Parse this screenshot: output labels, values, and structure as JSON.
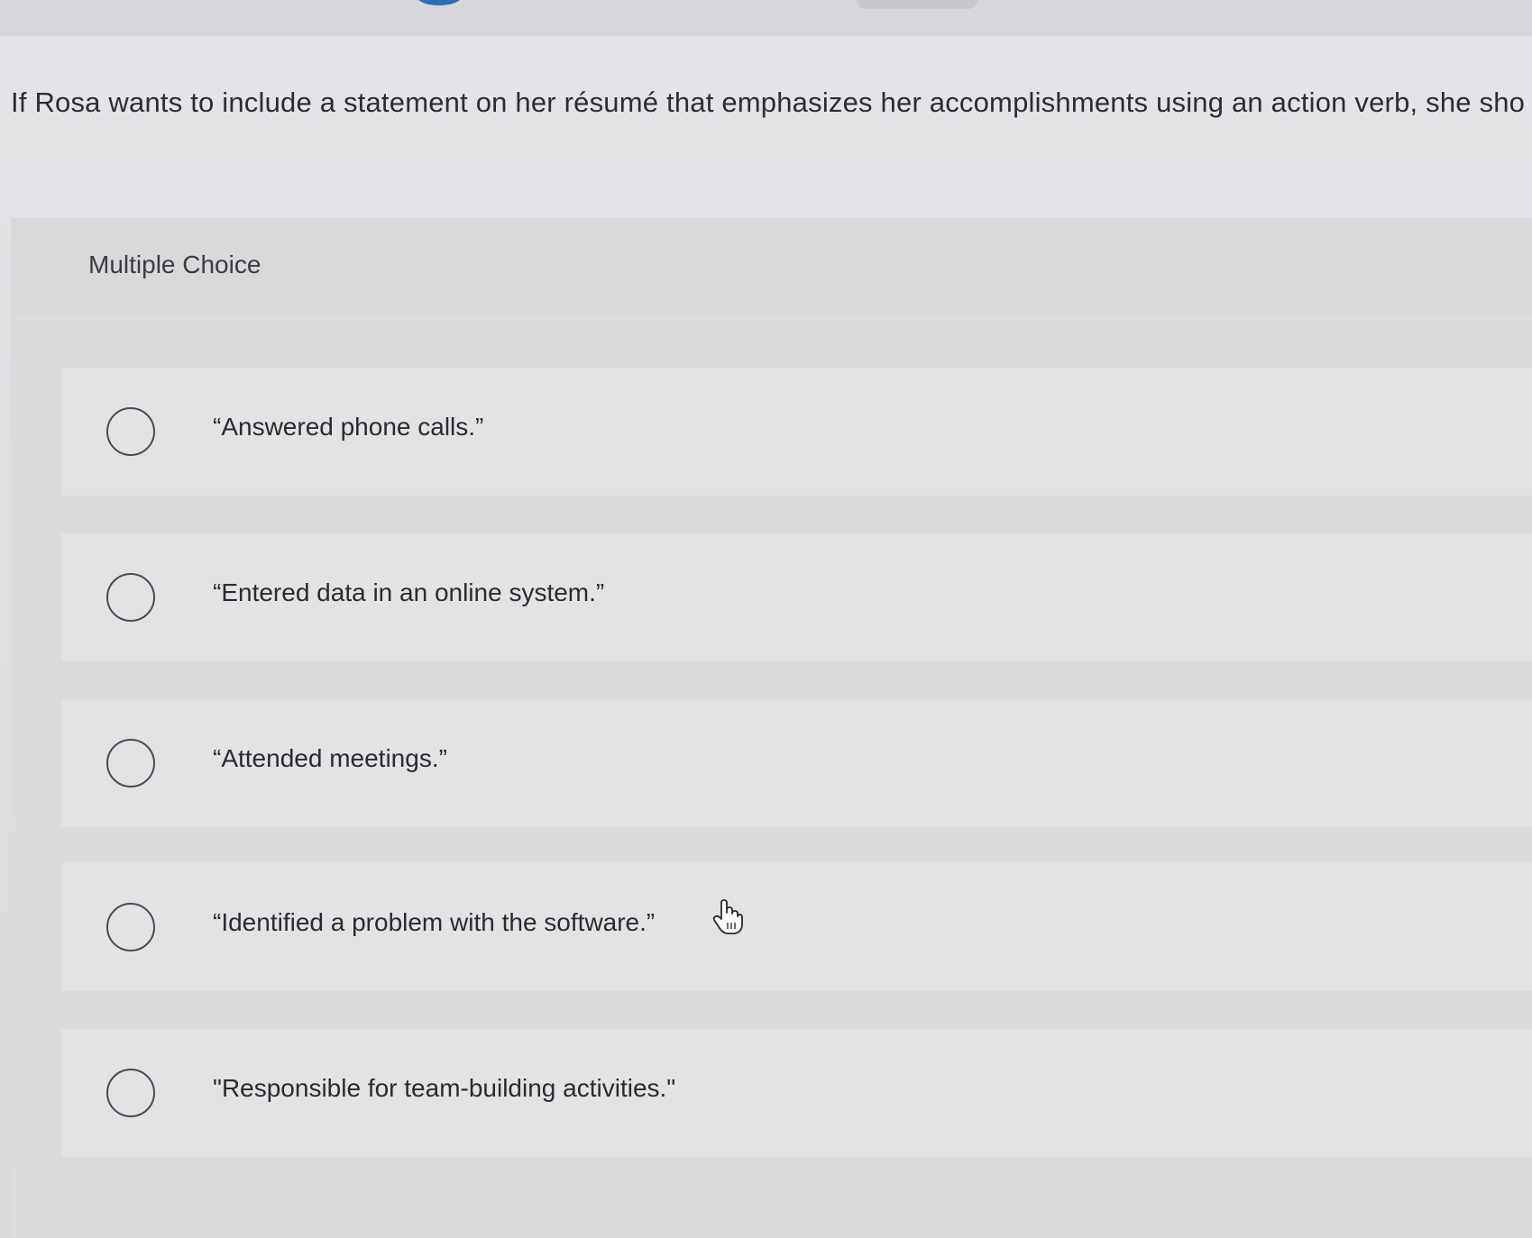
{
  "question": {
    "text": "If Rosa wants to include a statement on her résumé that emphasizes her accomplishments using an action verb, she sho"
  },
  "section": {
    "label": "Multiple Choice"
  },
  "options": [
    {
      "text": "“Answered phone calls.”"
    },
    {
      "text": "“Entered data in an online system.”"
    },
    {
      "text": "“Attended meetings.”"
    },
    {
      "text": "“Identified a problem with the software.”"
    },
    {
      "text": "\"Responsible for team-building activities.\""
    }
  ],
  "icons": {
    "radio": "radio-circle-icon",
    "pointer": "hand-pointer-icon"
  }
}
